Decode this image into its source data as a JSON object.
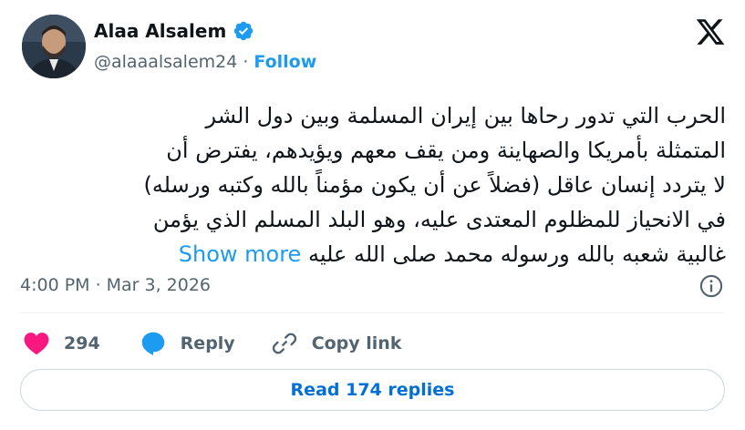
{
  "author": {
    "name": "Alaa Alsalem",
    "handle": "@alaaalsalem24",
    "separator": "·",
    "follow_label": "Follow",
    "verified": true
  },
  "tweet": {
    "lines": [
      "الحرب التي تدور رحاها بين إيران المسلمة وبين دول الشر",
      "المتمثلة بأمريكا والصهاينة ومن يقف معهم ويؤيدهم، يفترض أن",
      "لا يتردد إنسان عاقل (فضلاً عن أن يكون مؤمناً بالله وكتبه ورسله)",
      "في الانحياز للمظلوم المعتدى عليه، وهو البلد المسلم الذي يؤمن",
      "غالبية شعبه بالله ورسوله محمد صلى الله عليه"
    ],
    "show_more_label": "Show more"
  },
  "meta": {
    "time": "4:00 PM",
    "separator": "·",
    "date": "Mar 3, 2026"
  },
  "actions": {
    "likes_count": "294",
    "reply_label": "Reply",
    "copy_link_label": "Copy link"
  },
  "read_replies_label": "Read 174 replies",
  "colors": {
    "like": "#f91880",
    "link": "#1d9bf0",
    "reply_icon": "#1d9bf0",
    "muted": "#536471",
    "read_replies": "#006fd6"
  },
  "icons": [
    "verified-badge-icon",
    "x-logo-icon",
    "info-icon",
    "heart-icon",
    "reply-bubble-icon",
    "link-icon"
  ]
}
